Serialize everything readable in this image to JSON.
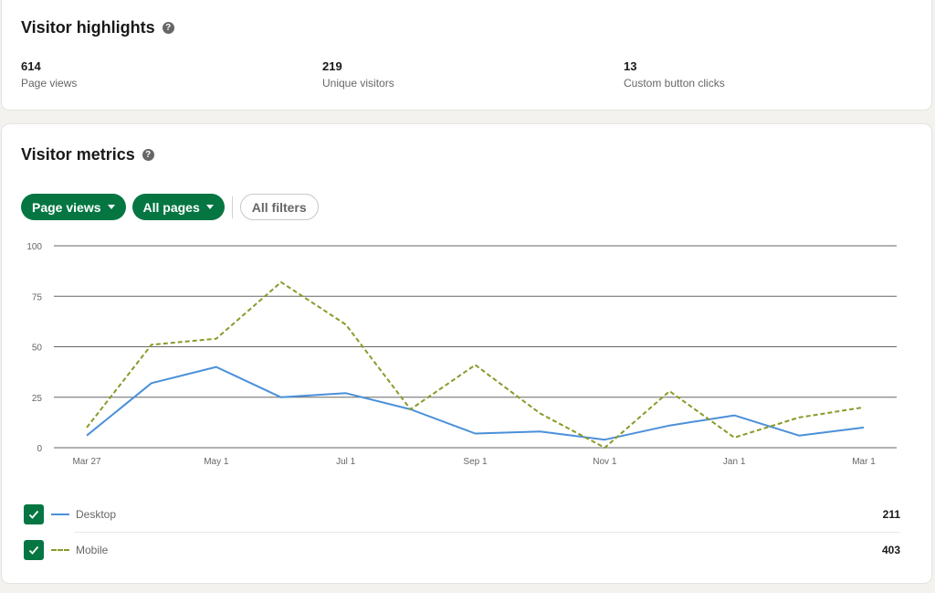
{
  "highlights": {
    "title": "Visitor highlights",
    "help_icon": "question-circle-icon",
    "stats": [
      {
        "value": "614",
        "label": "Page views"
      },
      {
        "value": "219",
        "label": "Unique visitors"
      },
      {
        "value": "13",
        "label": "Custom button clicks"
      }
    ]
  },
  "metrics": {
    "title": "Visitor metrics",
    "help_icon": "question-circle-icon",
    "filters": {
      "metric": "Page views",
      "pages": "All pages",
      "all_filters": "All filters"
    },
    "legend": [
      {
        "label": "Desktop",
        "total": "211",
        "checked": true
      },
      {
        "label": "Mobile",
        "total": "403",
        "checked": true
      }
    ]
  },
  "colors": {
    "accent": "#057642",
    "desktop": "#4a90d9",
    "mobile": "#8a9a2a"
  },
  "chart_data": {
    "type": "line",
    "title": "",
    "xlabel": "",
    "ylabel": "",
    "ylim": [
      0,
      100
    ],
    "yticks": [
      0,
      25,
      50,
      75,
      100
    ],
    "grid": true,
    "x_tick_labels": [
      {
        "index": 0,
        "label": "Mar 27"
      },
      {
        "index": 2,
        "label": "May 1"
      },
      {
        "index": 4,
        "label": "Jul 1"
      },
      {
        "index": 6,
        "label": "Sep 1"
      },
      {
        "index": 8,
        "label": "Nov 1"
      },
      {
        "index": 10,
        "label": "Jan 1"
      },
      {
        "index": 12,
        "label": "Mar 1"
      }
    ],
    "point_count": 13,
    "series": [
      {
        "name": "Desktop",
        "style": "solid",
        "values": [
          6,
          32,
          40,
          25,
          27,
          19,
          7,
          8,
          4,
          11,
          16,
          6,
          10
        ]
      },
      {
        "name": "Mobile",
        "style": "dashed",
        "values": [
          10,
          51,
          54,
          82,
          61,
          19,
          41,
          17,
          0,
          28,
          5,
          15,
          20
        ]
      }
    ]
  }
}
